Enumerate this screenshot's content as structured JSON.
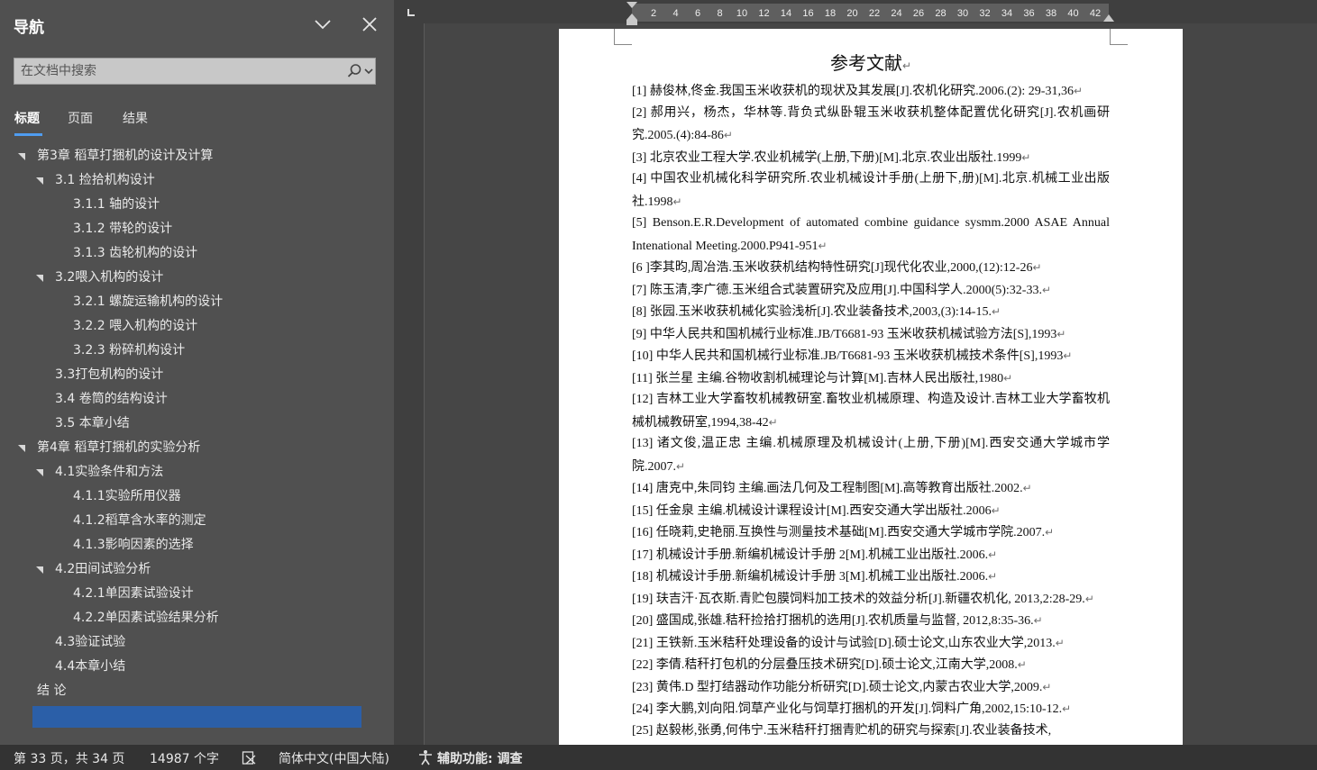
{
  "nav": {
    "title": "导航",
    "search_placeholder": "在文档中搜索",
    "tabs": [
      "标题",
      "页面",
      "结果"
    ],
    "outline": [
      {
        "label": "第3章 稻草打捆机的设计及计算",
        "level": 1,
        "expanded": true
      },
      {
        "label": "3.1 捡拾机构设计",
        "level": 2,
        "expanded": true
      },
      {
        "label": "3.1.1 轴的设计",
        "level": 3
      },
      {
        "label": "3.1.2 带轮的设计",
        "level": 3
      },
      {
        "label": "3.1.3 齿轮机构的设计",
        "level": 3
      },
      {
        "label": "3.2喂入机构的设计",
        "level": 2,
        "expanded": true
      },
      {
        "label": "3.2.1 螺旋运输机构的设计",
        "level": 3
      },
      {
        "label": "3.2.2 喂入机构的设计",
        "level": 3
      },
      {
        "label": "3.2.3 粉碎机构设计",
        "level": 3
      },
      {
        "label": "3.3打包机构的设计",
        "level": 2
      },
      {
        "label": "3.4 卷筒的结构设计",
        "level": 2
      },
      {
        "label": "3.5 本章小结",
        "level": 2
      },
      {
        "label": "第4章 稻草打捆机的实验分析",
        "level": 1,
        "expanded": true
      },
      {
        "label": "4.1实验条件和方法",
        "level": 2,
        "expanded": true
      },
      {
        "label": "4.1.1实验所用仪器",
        "level": 3
      },
      {
        "label": "4.1.2稻草含水率的测定",
        "level": 3
      },
      {
        "label": "4.1.3影响因素的选择",
        "level": 3
      },
      {
        "label": "4.2田间试验分析",
        "level": 2,
        "expanded": true
      },
      {
        "label": "4.2.1单因素试验设计",
        "level": 3
      },
      {
        "label": "4.2.2单因素试验结果分析",
        "level": 3
      },
      {
        "label": "4.3验证试验",
        "level": 2
      },
      {
        "label": "4.4本章小结",
        "level": 2
      },
      {
        "label": "结    论",
        "level": 1
      }
    ]
  },
  "ruler": {
    "ticks": [
      "2",
      "4",
      "6",
      "8",
      "10",
      "12",
      "14",
      "16",
      "18",
      "20",
      "22",
      "24",
      "26",
      "28",
      "30",
      "32",
      "34",
      "36",
      "38",
      "40",
      "42"
    ]
  },
  "document": {
    "title": "参考文献",
    "paragraph_mark": "↵",
    "references": [
      {
        "text": "[1]  赫俊林,佟金.我国玉米收获机的现状及其发展[J].农机化研究.2006.(2): 29-31,36",
        "lines": 1
      },
      {
        "text": "[2]  郝用兴，杨杰，华林等.背负式纵卧辊玉米收获机整体配置优化研究[J].农机画研究.2005.(4):84-86",
        "lines": 2
      },
      {
        "text": "[3]  北京农业工程大学.农业机械学(上册,下册)[M].北京.农业出版社.1999",
        "lines": 1
      },
      {
        "text": "[4]  中国农业机械化科学研究所.农业机械设计手册(上册下,册)[M].北京.机械工业出版社.1998",
        "lines": 2
      },
      {
        "text": "[5]  Benson.E.R.Development of automated combine guidance sysmm.2000 ASAE Annual Intenational Meeting.2000.P941-951",
        "lines": 2
      },
      {
        "text": "[6 ]李其昀,周冶浩.玉米收获机结构特性研究[J]现代化农业,2000,(12):12-26",
        "lines": 1
      },
      {
        "text": "[7]  陈玉清,李广德.玉米组合式装置研究及应用[J].中国科学人.2000(5):32-33.",
        "lines": 1
      },
      {
        "text": "[8]  张园.玉米收获机械化实验浅析[J].农业装备技术,2003,(3):14-15.",
        "lines": 1
      },
      {
        "text": "[9]  中华人民共和国机械行业标准.JB/T6681-93 玉米收获机械试验方法[S],1993",
        "lines": 1
      },
      {
        "text": "[10]  中华人民共和国机械行业标准.JB/T6681-93 玉米收获机械技术条件[S],1993",
        "lines": 1
      },
      {
        "text": "[11]  张兰星  主编.谷物收割机械理论与计算[M].吉林人民出版社,1980",
        "lines": 1
      },
      {
        "text": "[12]  吉林工业大学畜牧机械教研室.畜牧业机械原理、构造及设计.吉林工业大学畜牧机械机械教研室,1994,38-42",
        "lines": 2
      },
      {
        "text": "[13]  诸文俊,温正忠  主编.机械原理及机械设计(上册,下册)[M].西安交通大学城市学院.2007.",
        "lines": 2
      },
      {
        "text": "[14]  唐克中,朱同钧  主编.画法几何及工程制图[M].高等教育出版社.2002.",
        "lines": 1
      },
      {
        "text": "[15]  任金泉  主编.机械设计课程设计[M].西安交通大学出版社.2006",
        "lines": 1
      },
      {
        "text": "[16]  任晓莉,史艳丽.互换性与测量技术基础[M].西安交通大学城市学院.2007.",
        "lines": 1
      },
      {
        "text": "[17]  机械设计手册.新编机械设计手册 2[M].机械工业出版社.2006.",
        "lines": 1
      },
      {
        "text": "[18]  机械设计手册.新编机械设计手册 3[M].机械工业出版社.2006.",
        "lines": 1
      },
      {
        "text": "[19]  玞吉汗·瓦衣斯.青贮包膜饲料加工技术的效益分析[J].新疆农机化, 2013,2:28-29.",
        "lines": 1
      },
      {
        "text": "[20]  盛国成,张雄.秸秆捡拾打捆机的选用[J].农机质量与监督, 2012,8:35-36.",
        "lines": 1
      },
      {
        "text": "[21]  王铁新.玉米秸秆处理设备的设计与试验[D].硕士论文,山东农业大学,2013.",
        "lines": 1
      },
      {
        "text": "[22]  李倩.秸秆打包机的分层叠压技术研究[D].硕士论文,江南大学,2008.",
        "lines": 1
      },
      {
        "text": "[23]  黄伟.D  型打结器动作功能分析研究[D].硕士论文,内蒙古农业大学,2009.",
        "lines": 1
      },
      {
        "text": "[24]  李大鹏,刘向阳.饲草产业化与饲草打捆机的开发[J].饲料广角,2002,15:10-12.",
        "lines": 1
      },
      {
        "text": "[25]  赵毅彬,张勇,何伟宁.玉米秸秆打捆青贮机的研究与探索[J].农业装备技术,",
        "lines": 1,
        "no_mark": true
      }
    ]
  },
  "status": {
    "page": "第 33 页，共 34 页",
    "words": "14987 个字",
    "language": "简体中文(中国大陆)",
    "accessibility": "辅助功能: 调查"
  }
}
